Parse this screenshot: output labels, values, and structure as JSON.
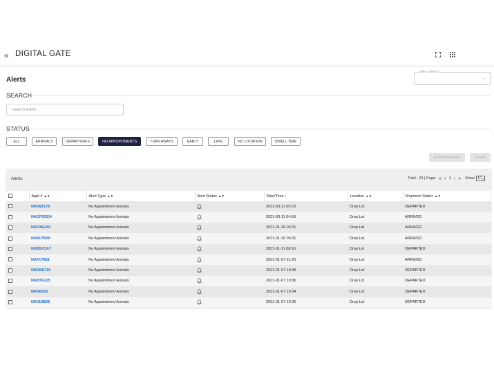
{
  "app": {
    "title": "DIGITAL GATE"
  },
  "page": {
    "title": "Alerts"
  },
  "site_select": {
    "label": "Site or Site ID"
  },
  "search": {
    "heading": "SEARCH",
    "placeholder": "Search Alerts"
  },
  "status": {
    "heading": "STATUS",
    "filters": [
      "ALL",
      "ARRIVALS",
      "DEPARTURES",
      "NO APPOINTMENTS",
      "TURN AWAYS",
      "EARLY",
      "LATE",
      "NO LOCATION",
      "DWELL TIME"
    ],
    "active_filter": "NO APPOINTMENTS"
  },
  "actions": {
    "acknowledge": "ACKNOWLEDGE",
    "clear": "CLEAR"
  },
  "table": {
    "title": "Alerts",
    "pagination": {
      "total_label": "Total : 23 | Page:",
      "page": "1",
      "show_label": "Show",
      "page_size": "10"
    },
    "columns": [
      "Appt #",
      "Alert Type",
      "Alert Status",
      "Date/Time",
      "Location",
      "Shipment Status"
    ],
    "rows": [
      {
        "appt": "NA06B179",
        "alert_type": "No Appointment Arrivals",
        "datetime": "2021-03-11 05:03",
        "location": "Drop Lot",
        "shipment_status": "DEPARTED"
      },
      {
        "appt": "NACFDED4",
        "alert_type": "No Appointment Arrivals",
        "datetime": "2021-03-11 04:58",
        "location": "Drop Lot",
        "shipment_status": "ARRIVED"
      },
      {
        "appt": "NAF95EA9",
        "alert_type": "No Appointment Arrivals",
        "datetime": "2021-01-26 06:31",
        "location": "Drop Lot",
        "shipment_status": "ARRIVED"
      },
      {
        "appt": "NA8F7B39",
        "alert_type": "No Appointment Arrivals",
        "datetime": "2021-01-26 06:31",
        "location": "Drop Lot",
        "shipment_status": "ARRIVED"
      },
      {
        "appt": "NAB50CA7",
        "alert_type": "No Appointment Arrivals",
        "datetime": "2021-01-11 08:16",
        "location": "Drop Lot",
        "shipment_status": "DEPARTED"
      },
      {
        "appt": "NAF17858",
        "alert_type": "No Appointment Arrivals",
        "datetime": "2021-01-07 21:20",
        "location": "Drop Lot",
        "shipment_status": "ARRIVED"
      },
      {
        "appt": "NAD81C15",
        "alert_type": "No Appointment Arrivals",
        "datetime": "2021-01-07 19:49",
        "location": "Drop Lot",
        "shipment_status": "DEPARTED"
      },
      {
        "appt": "NAB7E125",
        "alert_type": "No Appointment Arrivals",
        "datetime": "2021-01-07 19:36",
        "location": "Drop Lot",
        "shipment_status": "DEPARTED"
      },
      {
        "appt": "NA0E5B2",
        "alert_type": "No Appointment Arrivals",
        "datetime": "2021-01-07 19:34",
        "location": "Drop Lot",
        "shipment_status": "DEPARTED"
      },
      {
        "appt": "NA01882B",
        "alert_type": "No Appointment Arrivals",
        "datetime": "2021-01-07 19:30",
        "location": "Drop Lot",
        "shipment_status": "DEPARTED"
      }
    ]
  },
  "colors": {
    "active_filter_bg": "#1e2141",
    "link": "#1f6fd1"
  }
}
